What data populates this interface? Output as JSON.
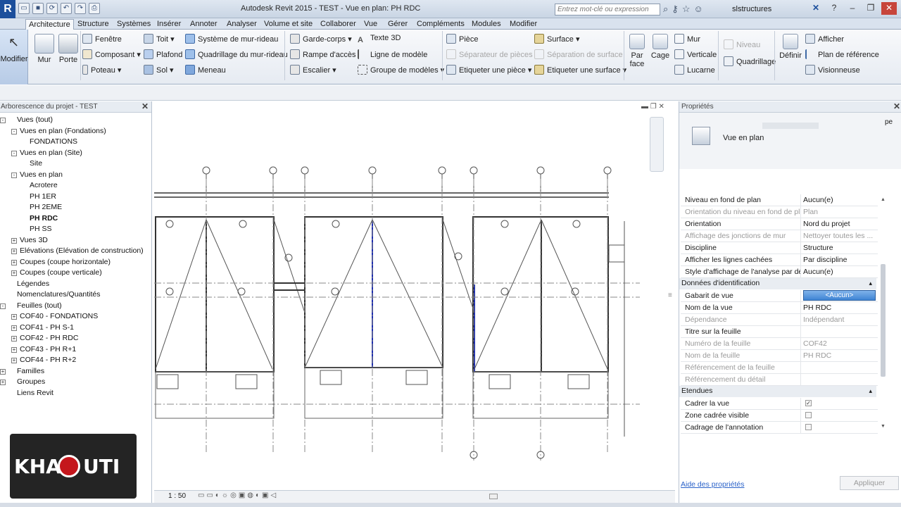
{
  "window": {
    "title": "Autodesk Revit 2015 -  TEST - Vue en plan: PH RDC",
    "search_placeholder": "Entrez mot-clé ou expression",
    "user": "slstructures"
  },
  "tabs": [
    "Architecture",
    "Structure",
    "Systèmes",
    "Insérer",
    "Annoter",
    "Analyser",
    "Volume et site",
    "Collaborer",
    "Vue",
    "Gérer",
    "Compléments",
    "Modules",
    "Modifier"
  ],
  "ribbon": {
    "modifier": "Modifier",
    "mur": "Mur",
    "porte": "Porte",
    "fenetre": "Fenêtre",
    "composant": "Composant",
    "poteau": "Poteau",
    "toit": "Toit",
    "plafond": "Plafond",
    "sol": "Sol",
    "systeme_mur_rideau": "Système de mur-rideau",
    "quadrillage_mur_rideau": "Quadrillage du mur-rideau",
    "meneau": "Meneau",
    "garde_corps": "Garde-corps",
    "rampe": "Rampe d'accès",
    "escalier": "Escalier",
    "texte_3d": "Texte 3D",
    "ligne_modele": "Ligne de modèle",
    "groupe_modeles": "Groupe de modèles",
    "piece": "Pièce",
    "separateur_pieces": "Séparateur de pièces",
    "etiqueter_piece": "Etiqueter  une pièce",
    "surface": "Surface",
    "separation_surface": "Séparation de surface",
    "etiqueter_surface": "Etiqueter  une surface",
    "par_face_1": "Par",
    "par_face_2": "face",
    "cage": "Cage",
    "mur2": "Mur",
    "verticale": "Verticale",
    "lucarne": "Lucarne",
    "niveau": "Niveau",
    "quadrillage": "Quadrillage",
    "definir": "Définir",
    "afficher": "Afficher",
    "plan_reference": "Plan de référence",
    "visionneuse": "Visionneuse"
  },
  "browser": {
    "title": "Arborescence du projet - TEST",
    "items": [
      {
        "label": "Vues (tout)",
        "level": 0,
        "toggle": "-"
      },
      {
        "label": "Vues en plan (Fondations)",
        "level": 1,
        "toggle": "-"
      },
      {
        "label": "FONDATIONS",
        "level": 2,
        "toggle": ""
      },
      {
        "label": "Vues en plan (Site)",
        "level": 1,
        "toggle": "-"
      },
      {
        "label": "Site",
        "level": 2,
        "toggle": ""
      },
      {
        "label": "Vues en plan",
        "level": 1,
        "toggle": "-"
      },
      {
        "label": "Acrotere",
        "level": 2,
        "toggle": ""
      },
      {
        "label": "PH 1ER",
        "level": 2,
        "toggle": ""
      },
      {
        "label": "PH 2EME",
        "level": 2,
        "toggle": ""
      },
      {
        "label": "PH RDC",
        "level": 2,
        "toggle": "",
        "bold": true
      },
      {
        "label": "PH SS",
        "level": 2,
        "toggle": ""
      },
      {
        "label": "Vues 3D",
        "level": 1,
        "toggle": "+"
      },
      {
        "label": "Elévations (Elévation de construction)",
        "level": 1,
        "toggle": "+"
      },
      {
        "label": "Coupes (coupe horizontale)",
        "level": 1,
        "toggle": "+"
      },
      {
        "label": "Coupes (coupe verticale)",
        "level": 1,
        "toggle": "+"
      },
      {
        "label": "Légendes",
        "level": 0,
        "toggle": ""
      },
      {
        "label": "Nomenclatures/Quantités",
        "level": 0,
        "toggle": ""
      },
      {
        "label": "Feuilles (tout)",
        "level": 0,
        "toggle": "-"
      },
      {
        "label": "COF40 - FONDATIONS",
        "level": 1,
        "toggle": "+"
      },
      {
        "label": "COF41 - PH S-1",
        "level": 1,
        "toggle": "+"
      },
      {
        "label": "COF42 - PH RDC",
        "level": 1,
        "toggle": "+"
      },
      {
        "label": "COF43 - PH R+1",
        "level": 1,
        "toggle": "+"
      },
      {
        "label": "COF44 - PH R+2",
        "level": 1,
        "toggle": "+"
      },
      {
        "label": "Familles",
        "level": 0,
        "toggle": "+"
      },
      {
        "label": "Groupes",
        "level": 0,
        "toggle": "+"
      },
      {
        "label": "Liens Revit",
        "level": 0,
        "toggle": ""
      }
    ]
  },
  "view": {
    "scale": "1 : 50"
  },
  "properties": {
    "title": "Propriétés",
    "type_name": "Vue en plan",
    "rows": [
      {
        "k": "Niveau en fond de plan",
        "v": "Aucun(e)",
        "dis": false
      },
      {
        "k": "Orientation du niveau en fond de pl...",
        "v": "Plan",
        "dis": true
      },
      {
        "k": "Orientation",
        "v": "Nord du projet",
        "dis": false
      },
      {
        "k": "Affichage des jonctions de mur",
        "v": "Nettoyer toutes les ...",
        "dis": true
      },
      {
        "k": "Discipline",
        "v": "Structure",
        "dis": false
      },
      {
        "k": "Afficher les lignes cachées",
        "v": "Par discipline",
        "dis": false
      },
      {
        "k": "Style d'affichage de l'analyse par dé...",
        "v": "Aucun(e)",
        "dis": false
      }
    ],
    "section_id": "Données d'identification",
    "rows2": [
      {
        "k": "Gabarit de vue",
        "v": "<Aucun>",
        "dis": false,
        "selected": true
      },
      {
        "k": "Nom de la vue",
        "v": "PH RDC",
        "dis": false
      },
      {
        "k": "Dépendance",
        "v": "Indépendant",
        "dis": true
      },
      {
        "k": "Titre sur la feuille",
        "v": "",
        "dis": false
      },
      {
        "k": "Numéro de la feuille",
        "v": "COF42",
        "dis": true
      },
      {
        "k": "Nom de la feuille",
        "v": "PH RDC",
        "dis": true
      },
      {
        "k": "Référencement de la feuille",
        "v": "",
        "dis": true
      },
      {
        "k": "Référencement du détail",
        "v": "",
        "dis": true
      }
    ],
    "section_ext": "Etendues",
    "rows3": [
      {
        "k": "Cadrer la vue",
        "checked": true
      },
      {
        "k": "Zone cadrée visible",
        "checked": false
      },
      {
        "k": "Cadrage de l'annotation",
        "checked": false
      }
    ],
    "help_link": "Aide des propriétés",
    "apply": "Appliquer"
  },
  "logo": {
    "text_left": "KHA",
    "text_right": "UTI"
  }
}
